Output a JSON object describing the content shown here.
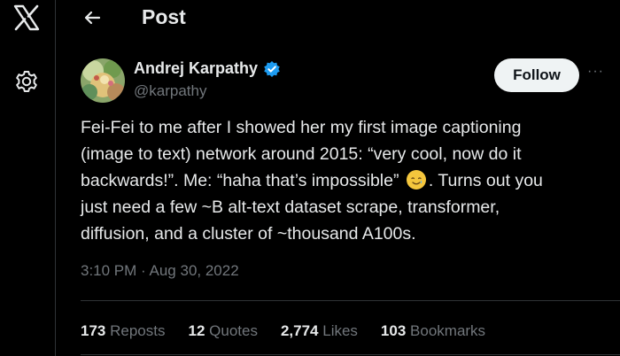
{
  "header": {
    "title": "Post",
    "back_icon": "arrow-left-icon"
  },
  "rail": {
    "logo_icon": "x-logo-icon",
    "settings_icon": "gear-icon"
  },
  "author": {
    "name": "Andrej Karpathy",
    "handle": "@karpathy",
    "verified": true,
    "verified_color": "#1d9bf0"
  },
  "follow_label": "Follow",
  "more_label": "···",
  "tweet": {
    "lines": [
      "Fei-Fei to me after I showed her my first image captioning",
      "(image to text) network around 2015: “very cool, now do it",
      "backwards!”. Me: “haha that’s impossible”",
      ". Turns out you",
      "just need a few ~B alt-text dataset scrape, transformer,",
      "diffusion, and a cluster of ~thousand A100s."
    ],
    "emoji": "smiling-face-with-tear"
  },
  "meta": {
    "time": "3:10 PM",
    "separator": "·",
    "date": "Aug 30, 2022"
  },
  "stats": [
    {
      "count": "173",
      "label": "Reposts"
    },
    {
      "count": "12",
      "label": "Quotes"
    },
    {
      "count": "2,774",
      "label": "Likes"
    },
    {
      "count": "103",
      "label": "Bookmarks"
    }
  ],
  "colors": {
    "background": "#000000",
    "text": "#e7e9ea",
    "muted": "#71767b",
    "divider": "#2f3336"
  }
}
